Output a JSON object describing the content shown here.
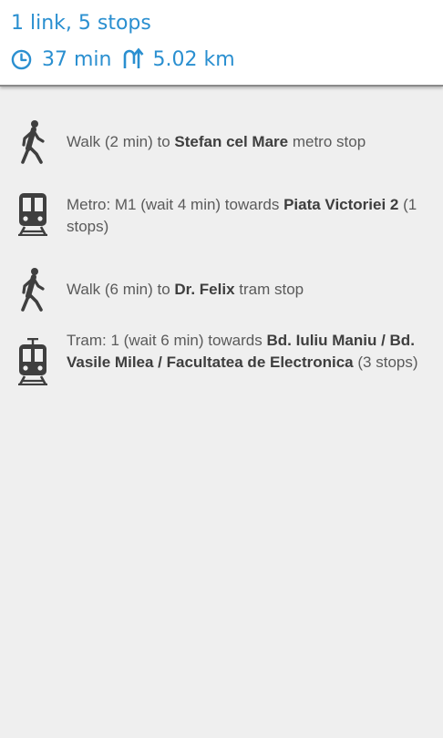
{
  "summary": {
    "title": "1 link, 5 stops",
    "duration": "37 min",
    "distance": "5.02 km",
    "icons": {
      "duration": "clock-icon",
      "distance": "u-turn-route-icon"
    },
    "accent_color": "#2a8fd0"
  },
  "steps": [
    {
      "icon": "walk-icon",
      "prefix": "Walk (2 min) to ",
      "place": "Stefan cel Mare",
      "suffix": " metro stop"
    },
    {
      "icon": "metro-train-icon",
      "prefix": "Metro: M1 (wait 4 min) towards ",
      "place": "Piata Victoriei 2",
      "suffix": " (1 stops)"
    },
    {
      "icon": "walk-icon",
      "prefix": "Walk (6 min) to ",
      "place": "Dr. Felix",
      "suffix": " tram stop"
    },
    {
      "icon": "tram-icon",
      "prefix": "Tram: 1 (wait 6 min) towards ",
      "place": "Bd. Iuliu Maniu / Bd. Vasile Milea / Facultatea de Electronica",
      "suffix": " (3 stops)"
    }
  ]
}
